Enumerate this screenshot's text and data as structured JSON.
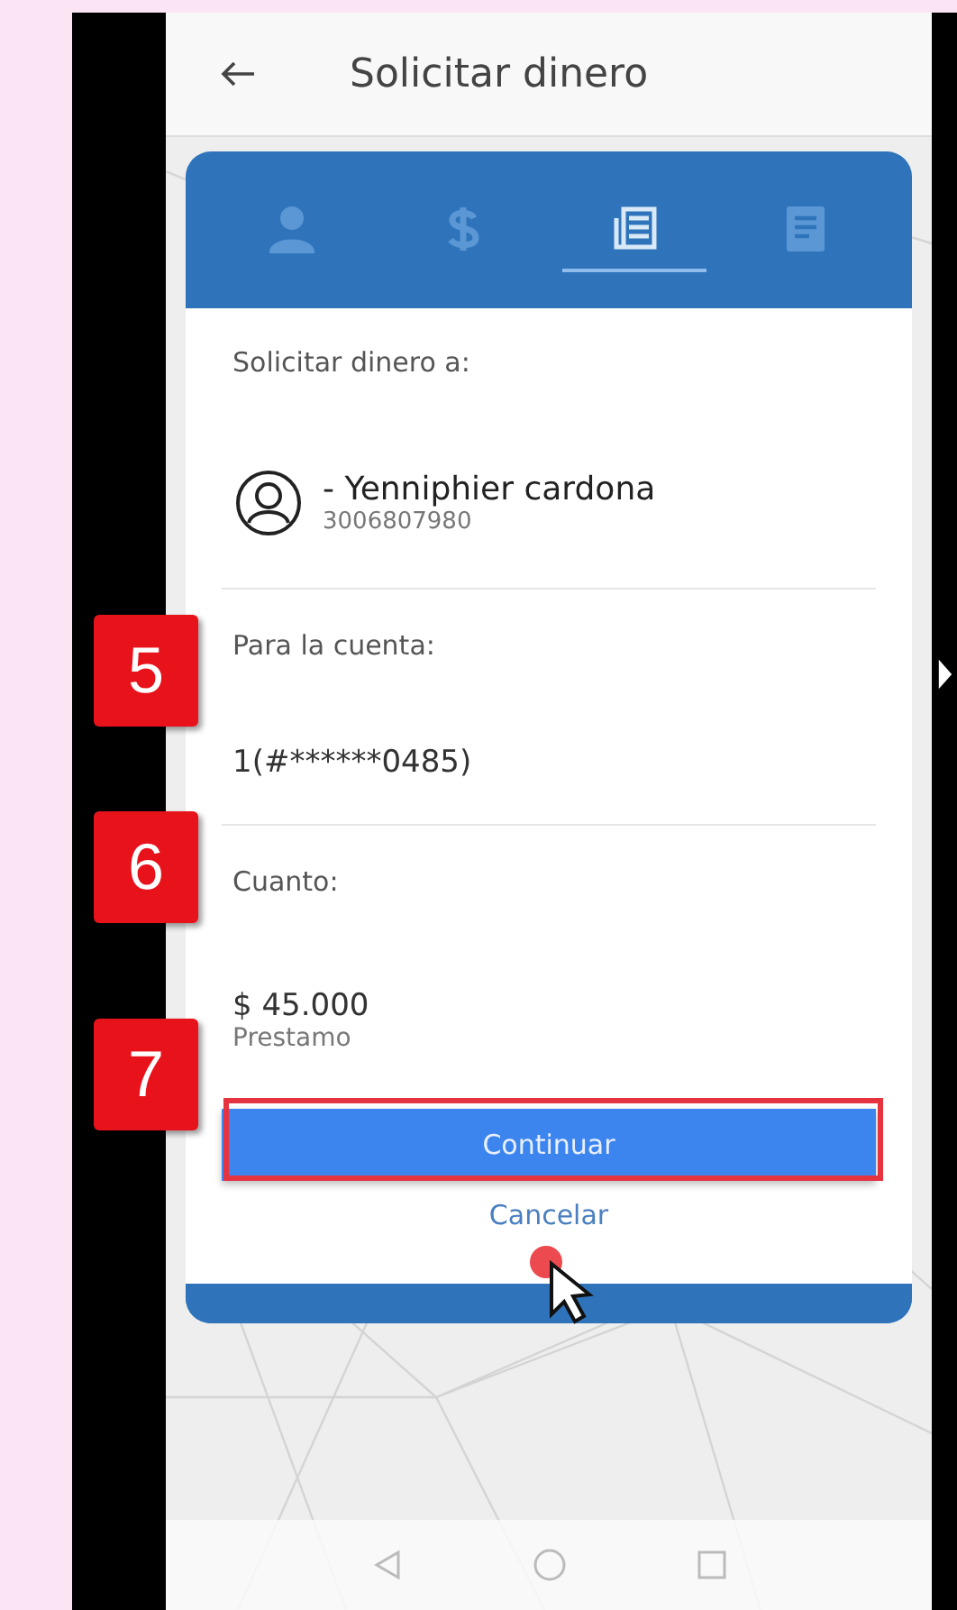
{
  "header": {
    "title": "Solicitar dinero"
  },
  "tabs": [
    {
      "kind": "person",
      "selected": false
    },
    {
      "kind": "dollar",
      "selected": false
    },
    {
      "kind": "receipt",
      "selected": true
    },
    {
      "kind": "document",
      "selected": false
    }
  ],
  "recipient": {
    "label": "Solicitar dinero a:",
    "name": "- Yenniphier cardona",
    "phone": "3006807980"
  },
  "account": {
    "label": "Para la cuenta:",
    "value": "1(#******0485)"
  },
  "amount": {
    "label": "Cuanto:",
    "value": "$ 45.000",
    "type": "Prestamo"
  },
  "buttons": {
    "primary": "Continuar",
    "secondary": "Cancelar"
  },
  "annotations": [
    {
      "label": "5"
    },
    {
      "label": "6"
    },
    {
      "label": "7"
    }
  ]
}
